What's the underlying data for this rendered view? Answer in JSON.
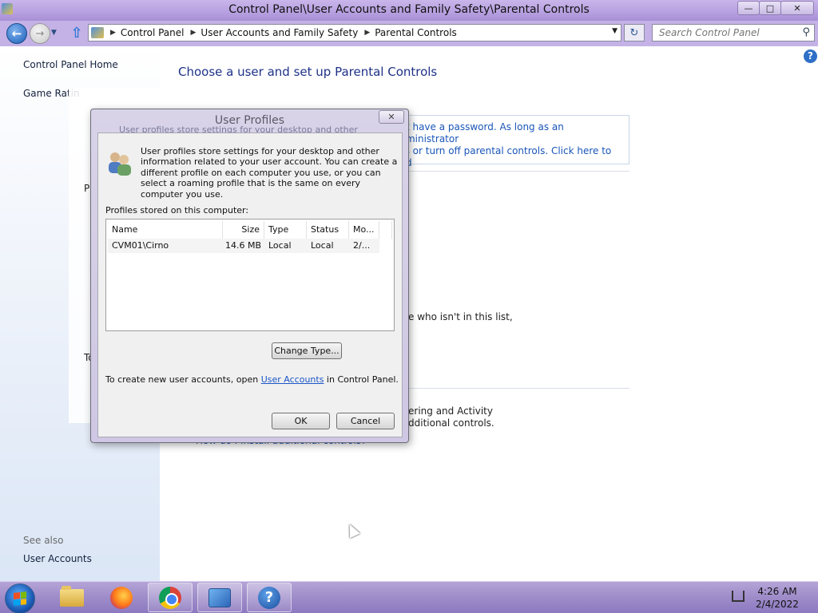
{
  "window": {
    "title": "Control Panel\\User Accounts and Family Safety\\Parental Controls",
    "buttons": {
      "minimize": "—",
      "maximize": "□",
      "close": "✕"
    }
  },
  "nav": {
    "breadcrumbs": [
      "Control Panel",
      "User Accounts and Family Safety",
      "Parental Controls"
    ],
    "search_placeholder": "Search Control Panel"
  },
  "sidebar": {
    "home": "Control Panel Home",
    "game_ratings": "Game Ratin",
    "see_also": "See also",
    "user_accounts": "User Accounts"
  },
  "main": {
    "title": "Choose a user and set up Parental Controls",
    "warning_line1": "not have a password. As long as an administrator",
    "warning_line2": "ass or turn off parental controls. Click here to add",
    "not_in_list": "e who isn't in this list,",
    "activity_line1": "ering and Activity",
    "activity_line2": "dditional controls.",
    "install_link": "How do I install additional controls?",
    "partial_pro": "Pro",
    "partial_to": "To"
  },
  "dialog": {
    "title": "User Profiles",
    "close_glyph": "✕",
    "ghost_text": "User profiles store settings for your desktop and other",
    "description": "User profiles store settings for your desktop and other information related to your user account. You can create a different profile on each computer you use, or you can select a roaming profile that is the same on every computer you use.",
    "stored_label": "Profiles stored on this computer:",
    "columns": [
      "Name",
      "Size",
      "Type",
      "Status",
      "Mo..."
    ],
    "rows": [
      {
        "name": "CVM01\\Cirno",
        "size": "14.6 MB",
        "type": "Local",
        "status": "Local",
        "modified": "2/..."
      }
    ],
    "change_type": "Change Type...",
    "create_prefix": "To create new user accounts, open ",
    "create_link": "User Accounts",
    "create_suffix": " in Control Panel.",
    "ok": "OK",
    "cancel": "Cancel"
  },
  "taskbar": {
    "time": "4:26 AM",
    "date": "2/4/2022"
  }
}
